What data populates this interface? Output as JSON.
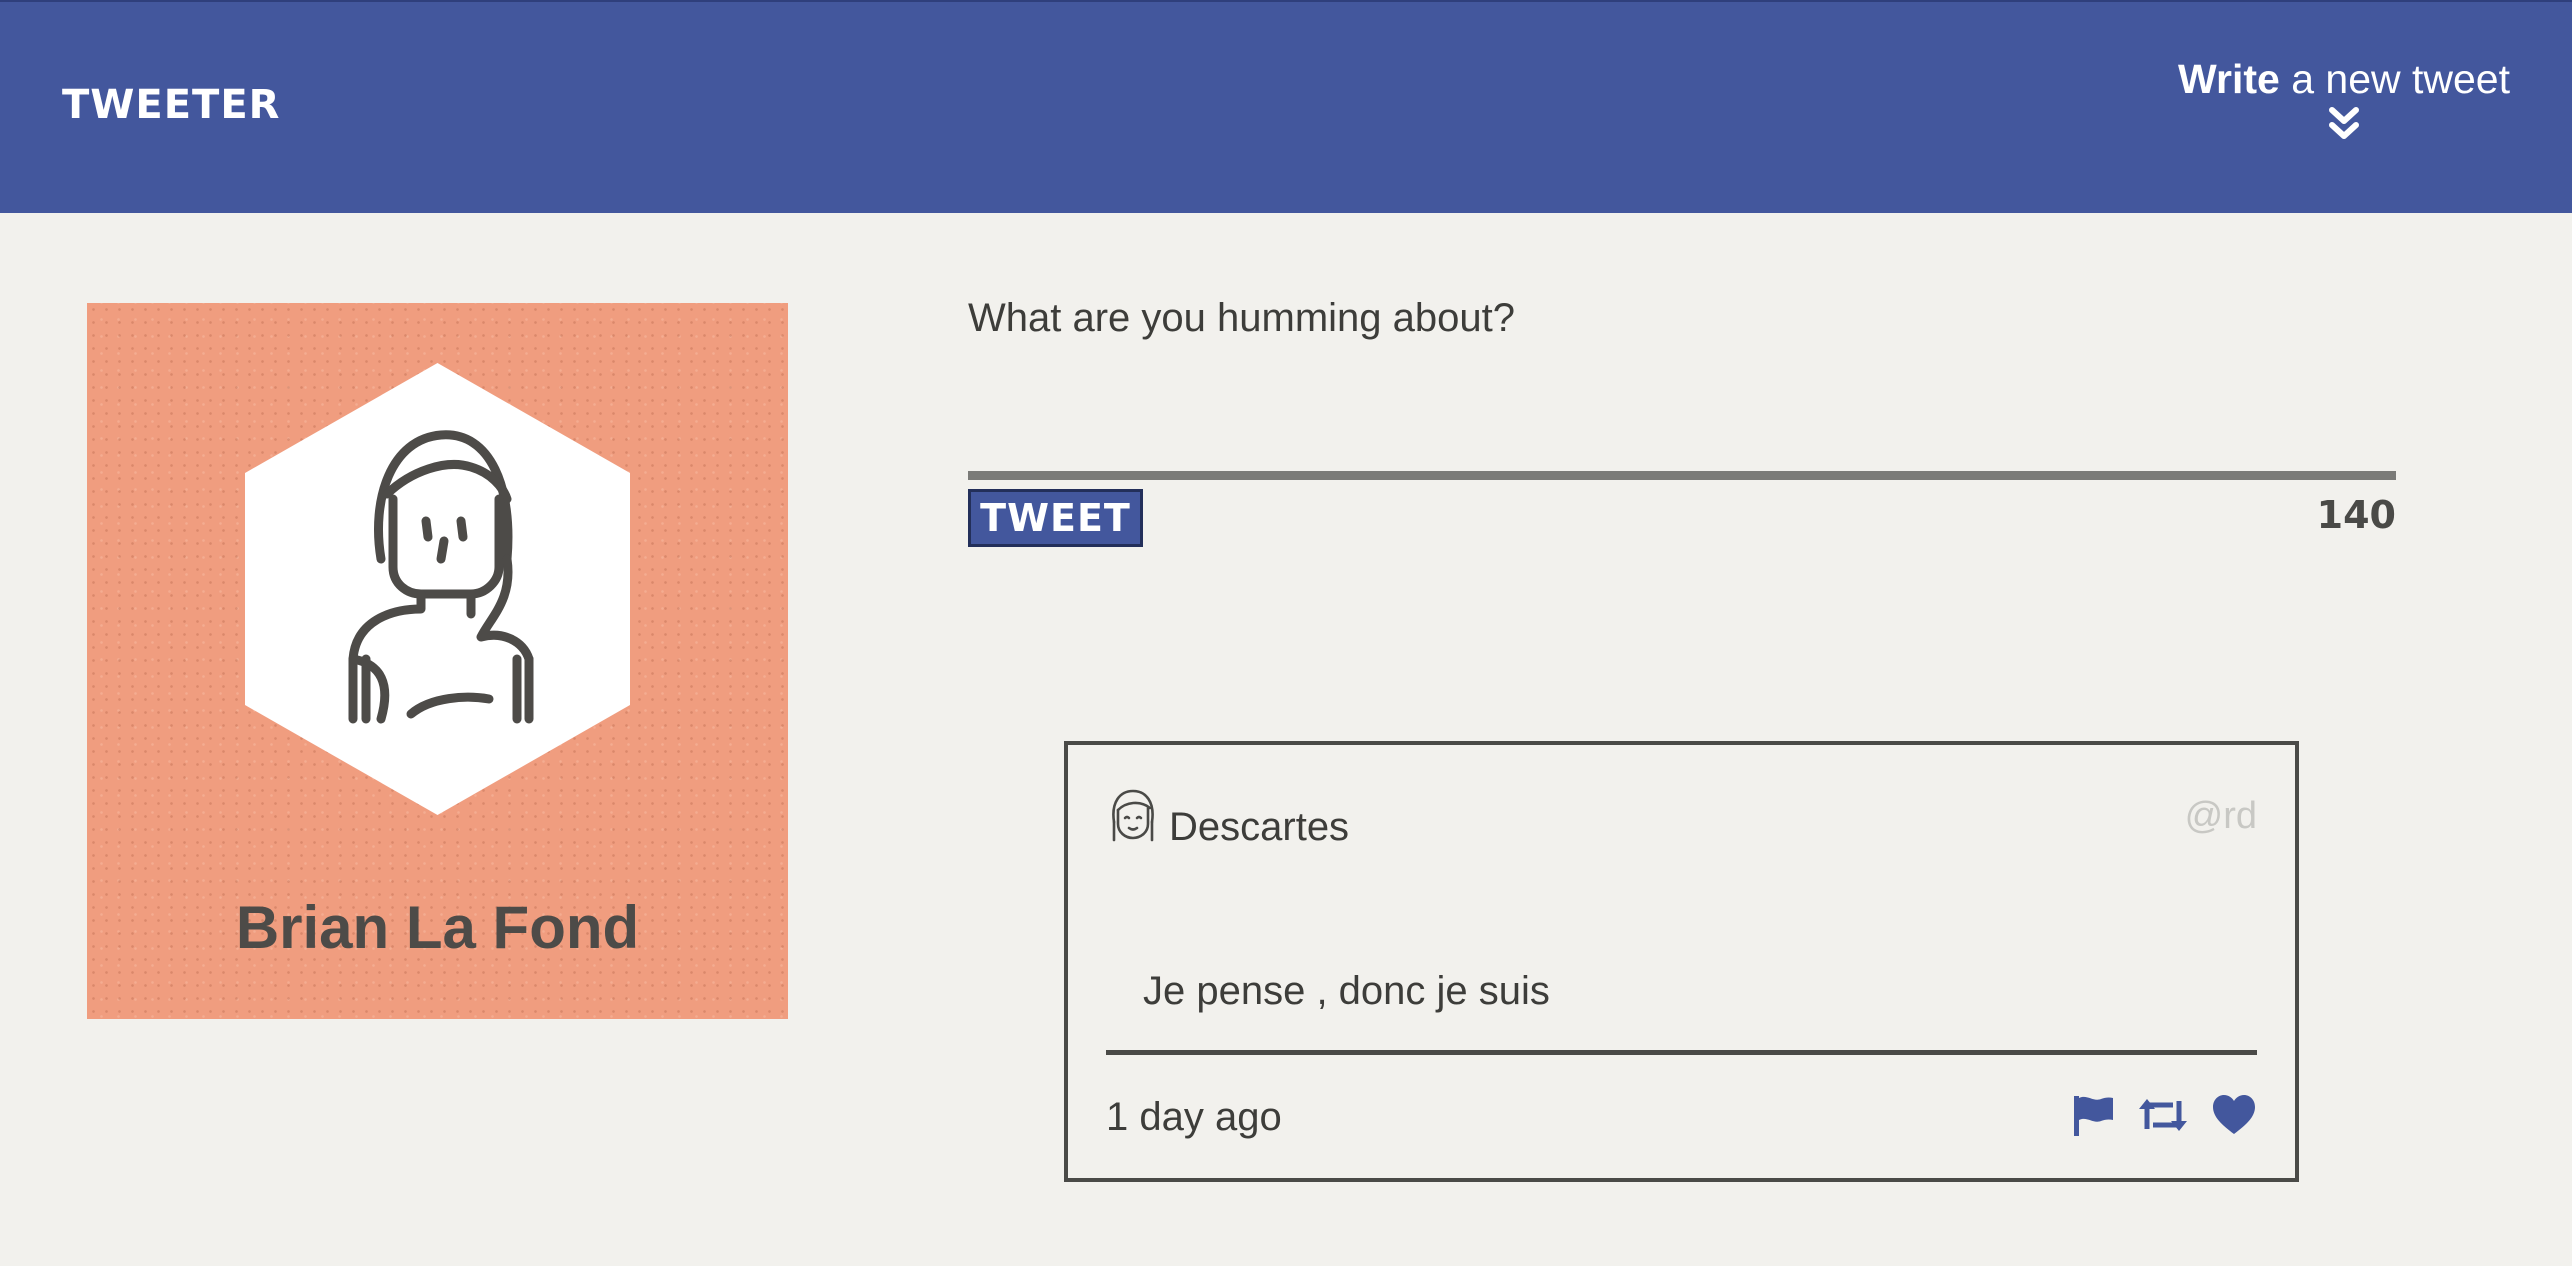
{
  "nav": {
    "brand": "TWEETER",
    "compose_toggle_bold": "Write",
    "compose_toggle_rest": " a new tweet",
    "compose_toggle_icon": "double-chevron-down-icon"
  },
  "profile": {
    "name": "Brian La Fond",
    "avatar_icon": "person-hexagon-avatar-icon",
    "background_color": "#f09d7f"
  },
  "compose": {
    "placeholder": "What are you humming about?",
    "value": "",
    "submit_label": "TWEET",
    "char_count": "140"
  },
  "tweets": [
    {
      "author": "Descartes",
      "handle": "@rd",
      "avatar_icon": "person-avatar-icon",
      "content": "Je pense , donc je suis",
      "time_ago": "1 day ago",
      "actions": [
        "flag-icon",
        "retweet-icon",
        "heart-icon"
      ]
    }
  ],
  "colors": {
    "accent": "#43579d",
    "background": "#f2f1ed",
    "text": "#4a4a47",
    "muted": "#c8c8c4"
  }
}
